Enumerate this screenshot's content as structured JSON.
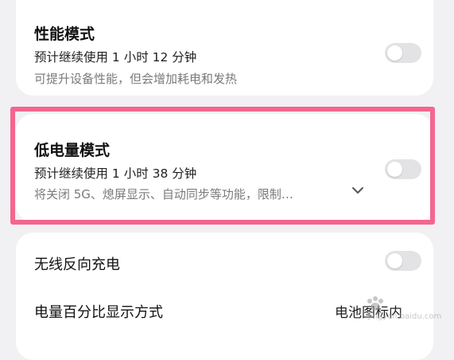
{
  "performance_mode": {
    "title": "性能模式",
    "estimate": "预计继续使用 1 小时 12 分钟",
    "description": "可提升设备性能，但会增加耗电和发热",
    "enabled": false
  },
  "low_power_mode": {
    "title": "低电量模式",
    "estimate": "预计继续使用 1 小时 38 分钟",
    "description": "将关闭 5G、熄屏显示、自动同步等功能，限制…",
    "enabled": false
  },
  "wireless_reverse_charging": {
    "title": "无线反向充电",
    "enabled": false
  },
  "battery_percentage_display": {
    "title": "电量百分比显示方式",
    "value": "电池图标内"
  },
  "watermark": {
    "text": "jingyan.baidu.com"
  },
  "colors": {
    "highlight_border": "#f4668f",
    "toggle_off": "#e3e3e6",
    "background": "#f1f1f3"
  }
}
